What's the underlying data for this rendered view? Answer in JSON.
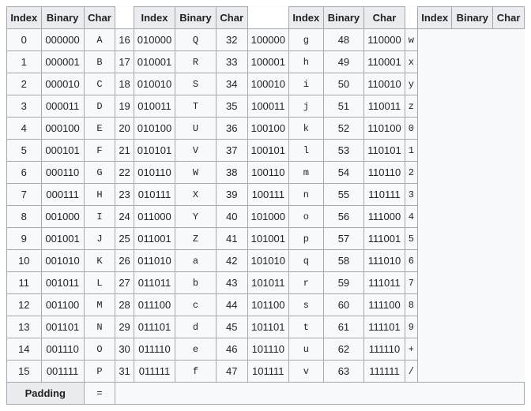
{
  "headers": {
    "index": "Index",
    "binary": "Binary",
    "char": "Char"
  },
  "padding": {
    "label": "Padding",
    "char": "="
  },
  "chart_data": {
    "type": "table",
    "title": "Base64 index table",
    "columns": [
      "Index",
      "Binary",
      "Char"
    ],
    "rows": [
      {
        "index": 0,
        "binary": "000000",
        "char": "A"
      },
      {
        "index": 1,
        "binary": "000001",
        "char": "B"
      },
      {
        "index": 2,
        "binary": "000010",
        "char": "C"
      },
      {
        "index": 3,
        "binary": "000011",
        "char": "D"
      },
      {
        "index": 4,
        "binary": "000100",
        "char": "E"
      },
      {
        "index": 5,
        "binary": "000101",
        "char": "F"
      },
      {
        "index": 6,
        "binary": "000110",
        "char": "G"
      },
      {
        "index": 7,
        "binary": "000111",
        "char": "H"
      },
      {
        "index": 8,
        "binary": "001000",
        "char": "I"
      },
      {
        "index": 9,
        "binary": "001001",
        "char": "J"
      },
      {
        "index": 10,
        "binary": "001010",
        "char": "K"
      },
      {
        "index": 11,
        "binary": "001011",
        "char": "L"
      },
      {
        "index": 12,
        "binary": "001100",
        "char": "M"
      },
      {
        "index": 13,
        "binary": "001101",
        "char": "N"
      },
      {
        "index": 14,
        "binary": "001110",
        "char": "O"
      },
      {
        "index": 15,
        "binary": "001111",
        "char": "P"
      },
      {
        "index": 16,
        "binary": "010000",
        "char": "Q"
      },
      {
        "index": 17,
        "binary": "010001",
        "char": "R"
      },
      {
        "index": 18,
        "binary": "010010",
        "char": "S"
      },
      {
        "index": 19,
        "binary": "010011",
        "char": "T"
      },
      {
        "index": 20,
        "binary": "010100",
        "char": "U"
      },
      {
        "index": 21,
        "binary": "010101",
        "char": "V"
      },
      {
        "index": 22,
        "binary": "010110",
        "char": "W"
      },
      {
        "index": 23,
        "binary": "010111",
        "char": "X"
      },
      {
        "index": 24,
        "binary": "011000",
        "char": "Y"
      },
      {
        "index": 25,
        "binary": "011001",
        "char": "Z"
      },
      {
        "index": 26,
        "binary": "011010",
        "char": "a"
      },
      {
        "index": 27,
        "binary": "011011",
        "char": "b"
      },
      {
        "index": 28,
        "binary": "011100",
        "char": "c"
      },
      {
        "index": 29,
        "binary": "011101",
        "char": "d"
      },
      {
        "index": 30,
        "binary": "011110",
        "char": "e"
      },
      {
        "index": 31,
        "binary": "011111",
        "char": "f"
      },
      {
        "index": 32,
        "binary": "100000",
        "char": "g"
      },
      {
        "index": 33,
        "binary": "100001",
        "char": "h"
      },
      {
        "index": 34,
        "binary": "100010",
        "char": "i"
      },
      {
        "index": 35,
        "binary": "100011",
        "char": "j"
      },
      {
        "index": 36,
        "binary": "100100",
        "char": "k"
      },
      {
        "index": 37,
        "binary": "100101",
        "char": "l"
      },
      {
        "index": 38,
        "binary": "100110",
        "char": "m"
      },
      {
        "index": 39,
        "binary": "100111",
        "char": "n"
      },
      {
        "index": 40,
        "binary": "101000",
        "char": "o"
      },
      {
        "index": 41,
        "binary": "101001",
        "char": "p"
      },
      {
        "index": 42,
        "binary": "101010",
        "char": "q"
      },
      {
        "index": 43,
        "binary": "101011",
        "char": "r"
      },
      {
        "index": 44,
        "binary": "101100",
        "char": "s"
      },
      {
        "index": 45,
        "binary": "101101",
        "char": "t"
      },
      {
        "index": 46,
        "binary": "101110",
        "char": "u"
      },
      {
        "index": 47,
        "binary": "101111",
        "char": "v"
      },
      {
        "index": 48,
        "binary": "110000",
        "char": "w"
      },
      {
        "index": 49,
        "binary": "110001",
        "char": "x"
      },
      {
        "index": 50,
        "binary": "110010",
        "char": "y"
      },
      {
        "index": 51,
        "binary": "110011",
        "char": "z"
      },
      {
        "index": 52,
        "binary": "110100",
        "char": "0"
      },
      {
        "index": 53,
        "binary": "110101",
        "char": "1"
      },
      {
        "index": 54,
        "binary": "110110",
        "char": "2"
      },
      {
        "index": 55,
        "binary": "110111",
        "char": "3"
      },
      {
        "index": 56,
        "binary": "111000",
        "char": "4"
      },
      {
        "index": 57,
        "binary": "111001",
        "char": "5"
      },
      {
        "index": 58,
        "binary": "111010",
        "char": "6"
      },
      {
        "index": 59,
        "binary": "111011",
        "char": "7"
      },
      {
        "index": 60,
        "binary": "111100",
        "char": "8"
      },
      {
        "index": 61,
        "binary": "111101",
        "char": "9"
      },
      {
        "index": 62,
        "binary": "111110",
        "char": "+"
      },
      {
        "index": 63,
        "binary": "111111",
        "char": "/"
      }
    ]
  }
}
